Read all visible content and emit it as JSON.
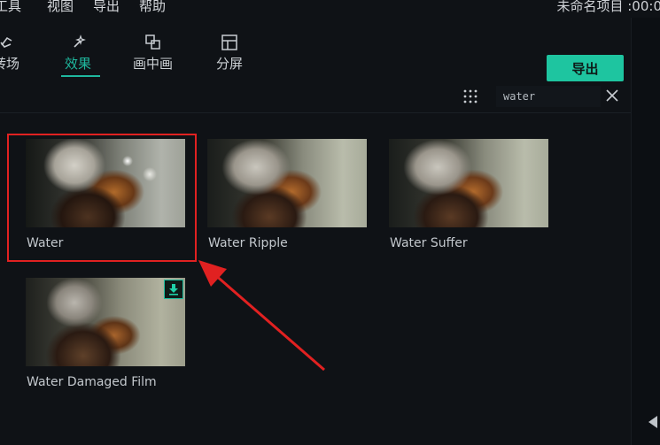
{
  "menu": {
    "items": [
      "工具",
      "视图",
      "导出",
      "帮助"
    ],
    "project_title": "未命名项目 :00:0"
  },
  "toolbar": {
    "tabs": [
      {
        "label": "转场",
        "icon": "transition-icon"
      },
      {
        "label": "效果",
        "icon": "effects-icon",
        "active": true
      },
      {
        "label": "画中画",
        "icon": "pip-icon"
      },
      {
        "label": "分屏",
        "icon": "split-screen-icon"
      }
    ],
    "export_label": "导出"
  },
  "search": {
    "value": "water"
  },
  "effects": [
    {
      "label": "Water",
      "highlighted": true
    },
    {
      "label": "Water Ripple"
    },
    {
      "label": "Water Suffer"
    },
    {
      "label": "Water Damaged Film",
      "downloadable": true
    }
  ],
  "colors": {
    "accent": "#1ec5a0",
    "background": "#0f1216",
    "annotation": "#e12121"
  }
}
